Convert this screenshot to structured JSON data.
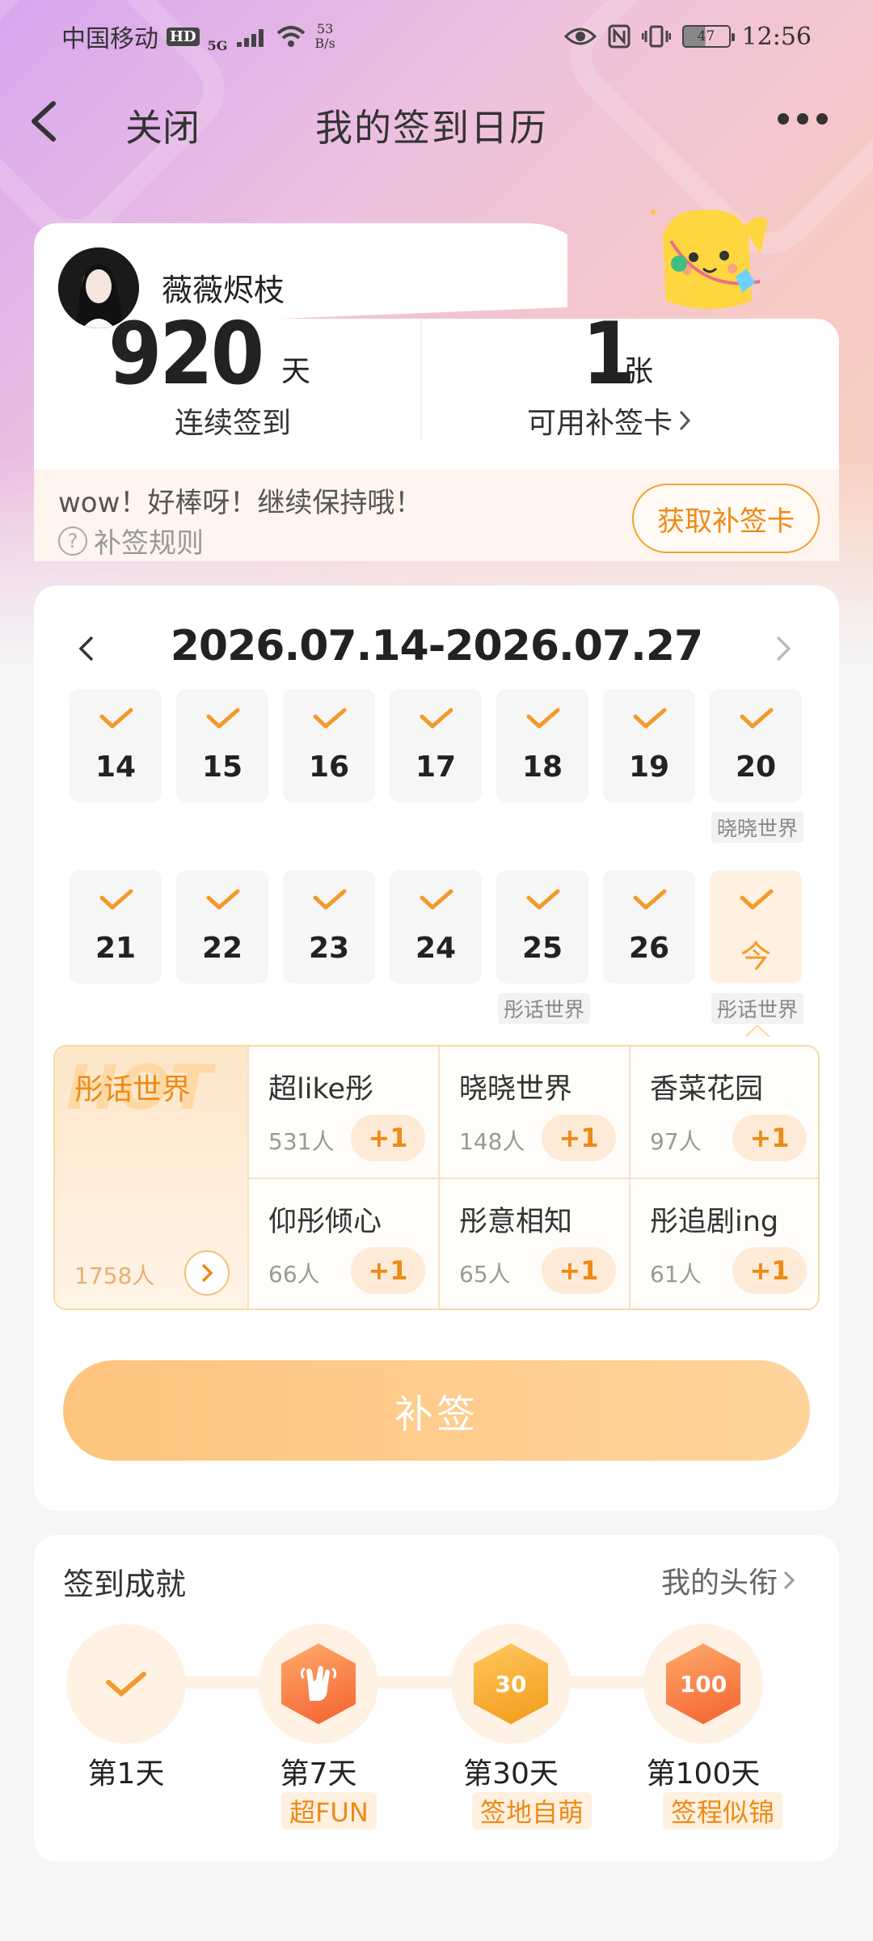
{
  "status_bar": {
    "carrier": "中国移动",
    "hd": "HD",
    "net_type": "5G",
    "speed_value": "53",
    "speed_unit": "B/s",
    "battery": "47",
    "time": "12:56"
  },
  "nav": {
    "close_label": "关闭",
    "title": "我的签到日历"
  },
  "profile": {
    "username": "薇薇烬枝",
    "streak_days": "920",
    "streak_unit": "天",
    "streak_label": "连续签到",
    "cards_count": "1",
    "cards_unit": "张",
    "cards_label": "可用补签卡",
    "message": "wow！好棒呀！继续保持哦！",
    "rule_label": "补签规则",
    "get_card_button": "获取补签卡"
  },
  "calendar": {
    "range": "2026.07.14-2026.07.27",
    "week1": [
      {
        "num": "14",
        "checked": true
      },
      {
        "num": "15",
        "checked": true
      },
      {
        "num": "16",
        "checked": true
      },
      {
        "num": "17",
        "checked": true
      },
      {
        "num": "18",
        "checked": true
      },
      {
        "num": "19",
        "checked": true
      },
      {
        "num": "20",
        "checked": true
      }
    ],
    "week2": [
      {
        "num": "21",
        "checked": true
      },
      {
        "num": "22",
        "checked": true
      },
      {
        "num": "23",
        "checked": true
      },
      {
        "num": "24",
        "checked": true
      },
      {
        "num": "25",
        "checked": true
      },
      {
        "num": "26",
        "checked": true
      },
      {
        "num": "今",
        "checked": true
      }
    ],
    "tags": {
      "day20": "晓晓世界",
      "day25": "彤话世界",
      "today": "彤话世界"
    }
  },
  "topics": {
    "featured": {
      "name": "彤话世界",
      "watermark": "HOT",
      "count": "1758人"
    },
    "items": [
      {
        "name": "超like彤",
        "count": "531人",
        "plus": "+1"
      },
      {
        "name": "晓晓世界",
        "count": "148人",
        "plus": "+1"
      },
      {
        "name": "香菜花园",
        "count": "97人",
        "plus": "+1"
      },
      {
        "name": "仰彤倾心",
        "count": "66人",
        "plus": "+1"
      },
      {
        "name": "彤意相知",
        "count": "65人",
        "plus": "+1"
      },
      {
        "name": "彤追剧ing",
        "count": "61人",
        "plus": "+1"
      }
    ]
  },
  "makeup_button": "补签",
  "achievements": {
    "title": "签到成就",
    "my_titles_link": "我的头衔",
    "milestones": [
      {
        "day": "第1天",
        "tag": "",
        "icon": "check-icon"
      },
      {
        "day": "第7天",
        "tag": "超FUN",
        "icon": "rock-hand-badge-icon"
      },
      {
        "day": "第30天",
        "tag": "签地自萌",
        "icon": "30-days-badge-icon",
        "badge_text": "30"
      },
      {
        "day": "第100天",
        "tag": "签程似锦",
        "icon": "100-days-badge-icon",
        "badge_text": "100"
      }
    ]
  },
  "colors": {
    "accent": "#F39A2A",
    "accent_light": "#FDEBD7",
    "button_gradient_start": "#FDC47D",
    "button_gradient_end": "#FED49B"
  }
}
